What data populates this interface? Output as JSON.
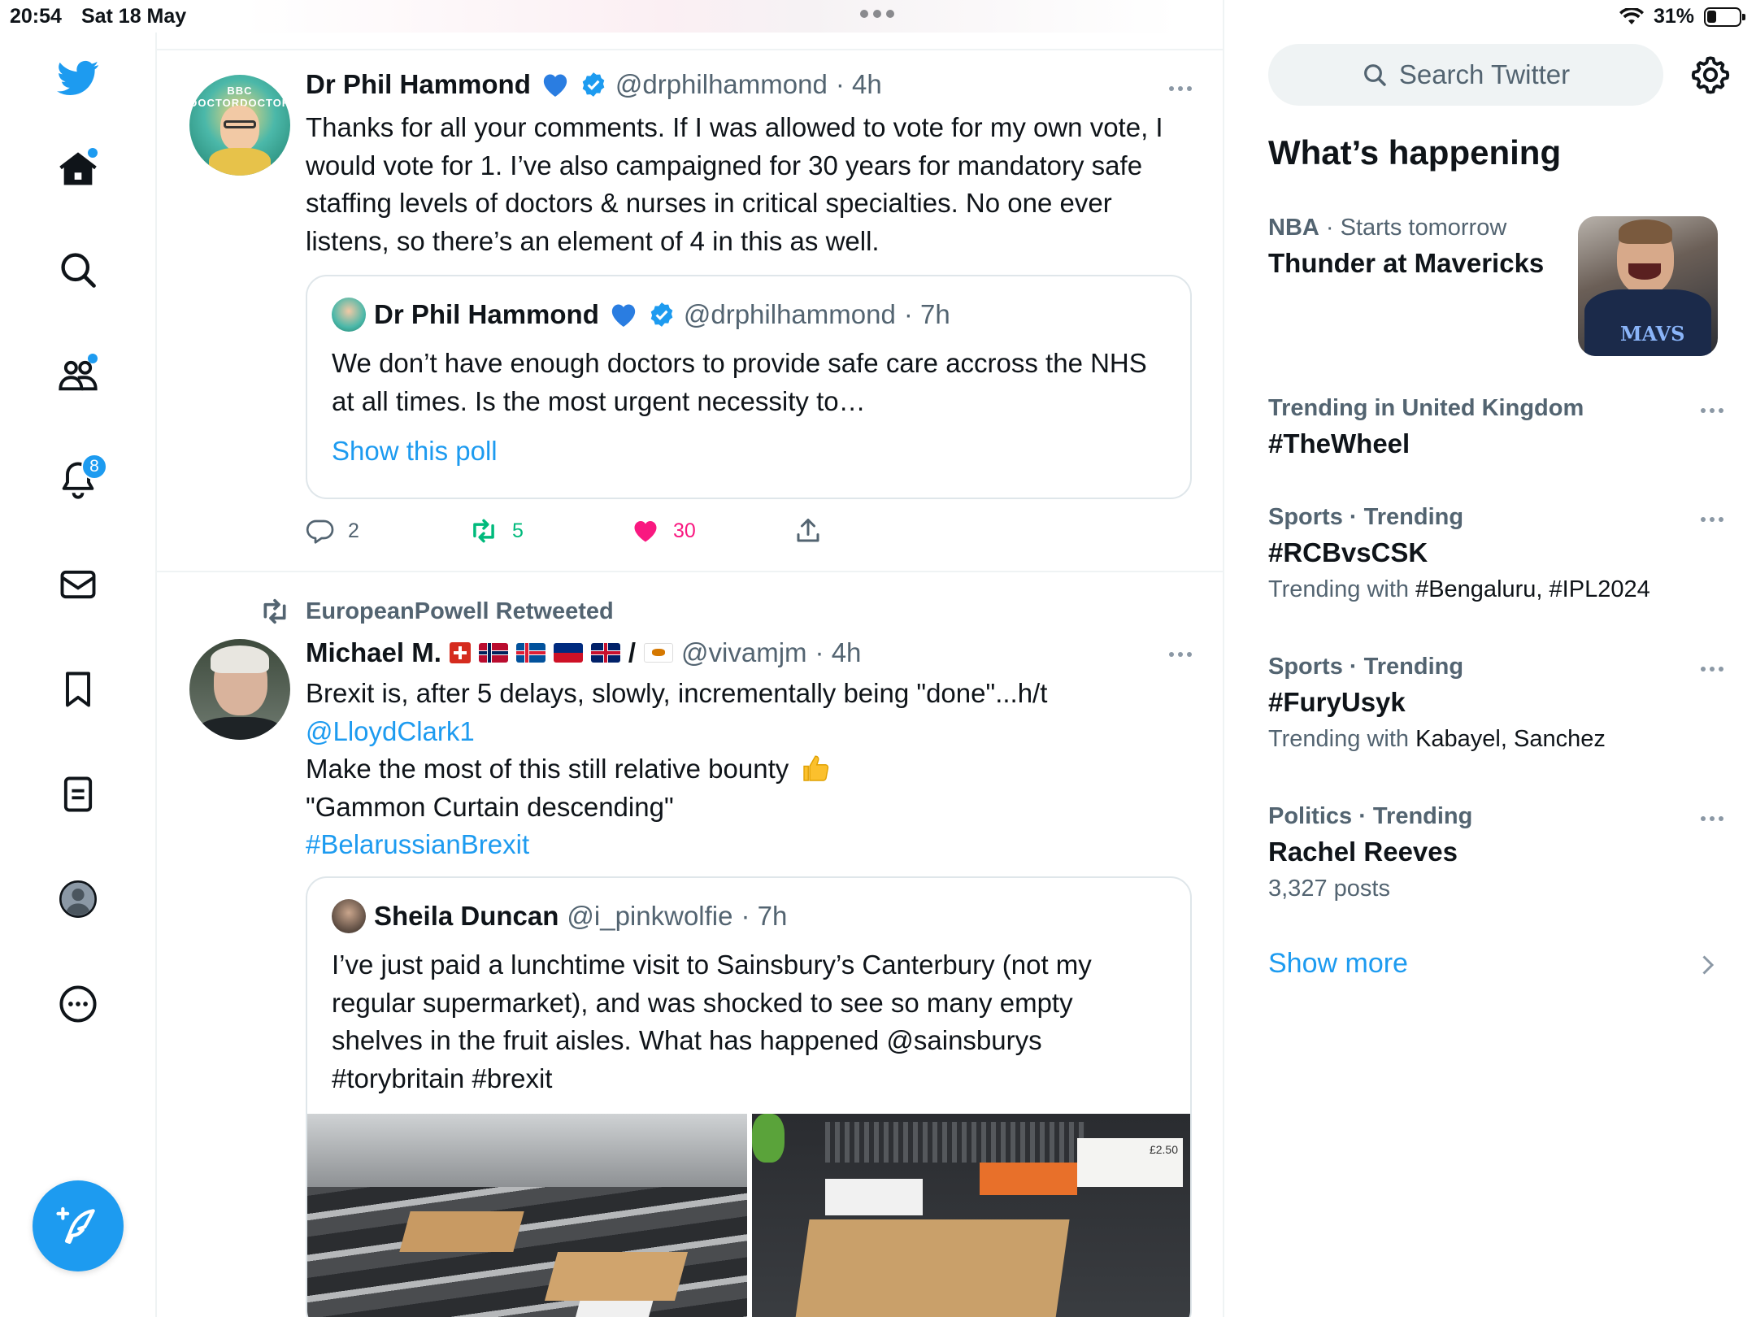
{
  "status_bar": {
    "time": "20:54",
    "date": "Sat 18 May",
    "battery": "31%",
    "battery_level": 0.31
  },
  "nav": {
    "notifications_count": "8"
  },
  "tweets": [
    {
      "name": "Dr Phil Hammond",
      "handle": "@drphilhammond",
      "time": "· 4h",
      "avatar_text": "BBC DOCTORDOCTOR",
      "text": "Thanks for all your comments. If I was allowed to vote for my own vote, I would vote for 1. I’ve also campaigned for 30 years for mandatory safe staffing levels of doctors & nurses in critical specialties. No one ever listens, so there’s an element of 4 in this as well.",
      "quote": {
        "name": "Dr Phil Hammond",
        "handle": "@drphilhammond",
        "time": "· 7h",
        "text": "We don’t have enough doctors to provide safe care accross the NHS at all times. Is the most urgent necessity to…",
        "poll_link": "Show this poll"
      },
      "stats": {
        "replies": "2",
        "retweets": "5",
        "likes": "30"
      }
    },
    {
      "retweeted_by": "EuropeanPowell Retweeted",
      "name": "Michael M.",
      "handle": "@vivamjm",
      "time": "· 4h",
      "flag_separator": "/",
      "text_line1": "Brexit is, after 5 delays, slowly, incrementally being \"done\"...h/t",
      "mention": "@LloydClark1",
      "text_line3": "Make the most of this still relative bounty",
      "text_line4": "\"Gammon Curtain descending\"",
      "hashtag": "#BelarussianBrexit",
      "quote": {
        "name": "Sheila Duncan",
        "handle": "@i_pinkwolfie",
        "time": "· 7h",
        "text": "I’ve just paid a lunchtime visit to Sainsbury’s Canterbury (not my regular supermarket), and was shocked to see so many empty shelves in the fruit aisles. What has happened @sainsburys #torybritain #brexit",
        "price_tag": "£2.50"
      }
    }
  ],
  "sidebar": {
    "search_placeholder": "Search Twitter",
    "section_title": "What’s happening",
    "trends": [
      {
        "category": "NBA",
        "meta": " · Starts tomorrow",
        "name": "Thunder at Mavericks",
        "with_label": "",
        "with_values": ""
      },
      {
        "category": "",
        "meta": "Trending in United Kingdom",
        "name": "#TheWheel",
        "with_label": "",
        "with_values": ""
      },
      {
        "category": "",
        "meta": "Sports · Trending",
        "name": "#RCBvsCSK",
        "with_label": "Trending with ",
        "with_values": "#Bengaluru, #IPL2024"
      },
      {
        "category": "",
        "meta": "Sports · Trending",
        "name": "#FuryUsyk",
        "with_label": "Trending with ",
        "with_values": "Kabayel, Sanchez"
      },
      {
        "category": "",
        "meta": "Politics · Trending",
        "name": "Rachel Reeves",
        "with_label": "3,327 posts",
        "with_values": ""
      }
    ],
    "nba_image_text": "MAVS",
    "show_more": "Show more"
  },
  "colors": {
    "accent": "#1d9bf0",
    "like": "#f91880",
    "retweet": "#00ba7c",
    "secondary_text": "#536471"
  }
}
